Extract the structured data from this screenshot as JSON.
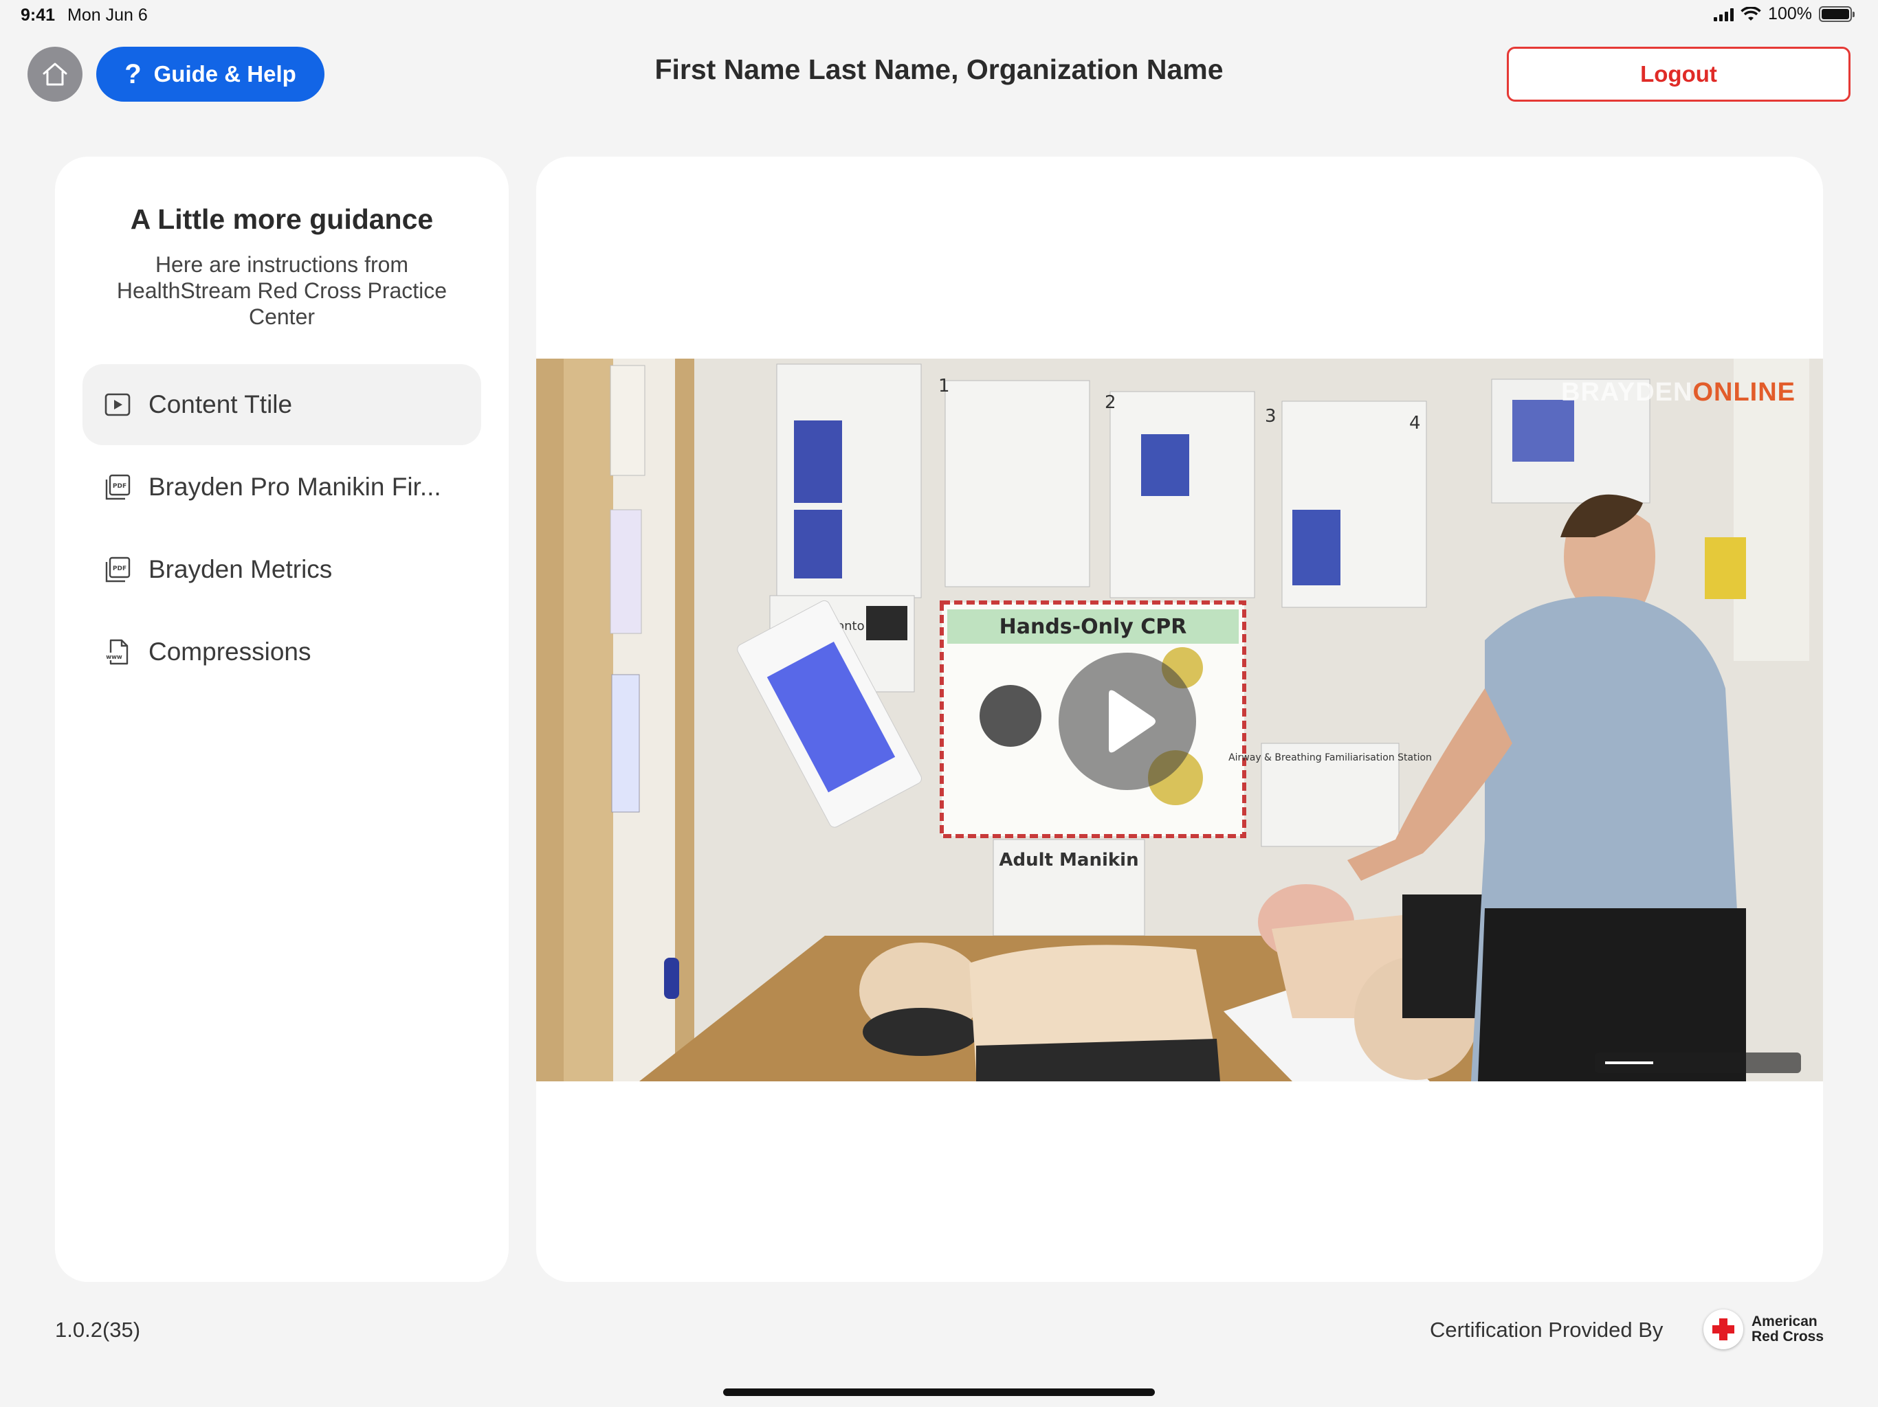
{
  "status_bar": {
    "time": "9:41",
    "date": "Mon Jun 6",
    "battery_percent": "100%"
  },
  "header": {
    "guide_label": "Guide & Help",
    "guide_icon_glyph": "?",
    "user_org": "First Name Last Name, Organization Name",
    "logout_label": "Logout"
  },
  "sidebar": {
    "title": "A Little more guidance",
    "subtitle": "Here are instructions from HealthStream Red Cross Practice Center",
    "items": [
      {
        "label": "Content Ttile",
        "icon": "video-play-icon",
        "active": true
      },
      {
        "label": "Brayden Pro Manikin Fir...",
        "icon": "pdf-icon",
        "active": false
      },
      {
        "label": "Brayden Metrics",
        "icon": "pdf-icon",
        "active": false
      },
      {
        "label": "Compressions",
        "icon": "www-file-icon",
        "active": false
      }
    ]
  },
  "video": {
    "watermark_a": "BRAYDEN",
    "watermark_b": "ONLINE",
    "poster_labels": [
      "1",
      "2",
      "3",
      "4"
    ],
    "banner": "Hands-Only CPR",
    "sign_manikin": "Adult Manikin",
    "sign_ipad": "Logging onto iPad",
    "sign_airway": "Airway & Breathing Familiarisation Station"
  },
  "footer": {
    "version": "1.0.2(35)",
    "certification_text": "Certification Provided By",
    "logo_line1": "American",
    "logo_line2": "Red Cross"
  },
  "colors": {
    "primary_blue": "#1265e6",
    "logout_red": "#e53935",
    "background": "#f4f4f4",
    "panel": "#ffffff",
    "red_cross": "#e31b23"
  }
}
